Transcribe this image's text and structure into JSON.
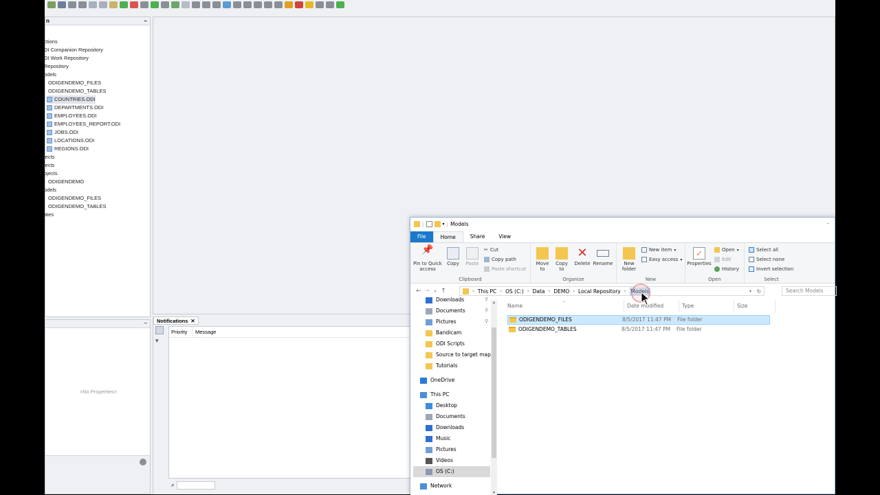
{
  "ide": {
    "tree_header": "n",
    "tree_items": [
      {
        "label": "ctions",
        "indent": 0,
        "icon": false
      },
      {
        "label": "DI Companion Repository",
        "indent": 0,
        "icon": false
      },
      {
        "label": "DI Work Repository",
        "indent": 0,
        "icon": false
      },
      {
        "label": "Repository",
        "indent": 0,
        "icon": false
      },
      {
        "label": "odels",
        "indent": 0,
        "icon": false
      },
      {
        "label": "ODIGENDEMO_FILES",
        "indent": 1,
        "icon": false
      },
      {
        "label": "ODIGENDEMO_TABLES",
        "indent": 1,
        "icon": false
      },
      {
        "label": "COUNTRIES.ODI",
        "indent": 2,
        "icon": true,
        "selected": true
      },
      {
        "label": "DEPARTMENTS.ODI",
        "indent": 2,
        "icon": true
      },
      {
        "label": "EMPLOYEES.ODI",
        "indent": 2,
        "icon": true
      },
      {
        "label": "EMPLOYEES_REPORT.ODI",
        "indent": 2,
        "icon": true
      },
      {
        "label": "JOBS.ODI",
        "indent": 2,
        "icon": true
      },
      {
        "label": "LOCATIONS.ODI",
        "indent": 2,
        "icon": true
      },
      {
        "label": "REGIONS.ODI",
        "indent": 2,
        "icon": true
      },
      {
        "label": "jects",
        "indent": 0,
        "icon": false
      },
      {
        "label": "jects",
        "indent": 0,
        "icon": false
      },
      {
        "label": "ojects",
        "indent": 0,
        "icon": false
      },
      {
        "label": "ODIGENDEMO",
        "indent": 1,
        "icon": false
      },
      {
        "label": "odels",
        "indent": 0,
        "icon": false
      },
      {
        "label": "ODIGENDEMO_FILES",
        "indent": 1,
        "icon": false
      },
      {
        "label": "ODIGENDEMO_TABLES",
        "indent": 1,
        "icon": false
      },
      {
        "label": "ates",
        "indent": 0,
        "icon": false
      }
    ],
    "properties_empty": "<No Properties>",
    "notifications_tab": "Notifications",
    "notifications_columns": [
      "Priority",
      "Message"
    ]
  },
  "explorer": {
    "title": "Models",
    "tabs": [
      "File",
      "Home",
      "Share",
      "View"
    ],
    "ribbon": {
      "clipboard": {
        "label": "Clipboard",
        "pin": "Pin to Quick access",
        "copy": "Copy",
        "paste": "Paste",
        "cut": "Cut",
        "copy_path": "Copy path",
        "paste_shortcut": "Paste shortcut"
      },
      "organize": {
        "label": "Organize",
        "move_to": "Move to",
        "copy_to": "Copy to",
        "delete": "Delete",
        "rename": "Rename"
      },
      "new": {
        "label": "New",
        "new_folder": "New folder",
        "new_item": "New item",
        "easy_access": "Easy access"
      },
      "open": {
        "label": "Open",
        "properties": "Properties",
        "open": "Open",
        "edit": "Edit",
        "history": "History"
      },
      "select": {
        "label": "Select",
        "select_all": "Select all",
        "select_none": "Select none",
        "invert": "Invert selection"
      }
    },
    "breadcrumbs": [
      "This PC",
      "OS (C:)",
      "Data",
      "DEMO",
      "Local Repository",
      "Models"
    ],
    "search_placeholder": "Search Models",
    "nav_items": [
      {
        "label": "Downloads",
        "icon": "download-icon",
        "pinned": true,
        "level": 1
      },
      {
        "label": "Documents",
        "icon": "documents-icon",
        "pinned": true,
        "level": 1
      },
      {
        "label": "Pictures",
        "icon": "pictures-icon",
        "pinned": true,
        "level": 1
      },
      {
        "label": "Bandicam",
        "icon": "folder-icon",
        "level": 1
      },
      {
        "label": "ODI Scripts",
        "icon": "folder-icon",
        "level": 1
      },
      {
        "label": "Source to target mappi",
        "icon": "folder-icon",
        "level": 1
      },
      {
        "label": "Tutorials",
        "icon": "folder-icon",
        "level": 1
      },
      {
        "label": "OneDrive",
        "icon": "onedrive-icon",
        "level": 0
      },
      {
        "label": "This PC",
        "icon": "computer-icon",
        "level": 0
      },
      {
        "label": "Desktop",
        "icon": "desktop-icon",
        "level": 1
      },
      {
        "label": "Documents",
        "icon": "documents-icon",
        "level": 1
      },
      {
        "label": "Downloads",
        "icon": "download-icon",
        "level": 1
      },
      {
        "label": "Music",
        "icon": "music-icon",
        "level": 1
      },
      {
        "label": "Pictures",
        "icon": "pictures-icon",
        "level": 1
      },
      {
        "label": "Videos",
        "icon": "videos-icon",
        "level": 1
      },
      {
        "label": "OS (C:)",
        "icon": "drive-icon",
        "level": 1,
        "selected": true
      },
      {
        "label": "Network",
        "icon": "network-icon",
        "level": 0
      }
    ],
    "columns": [
      "Name",
      "Date modified",
      "Type",
      "Size"
    ],
    "files": [
      {
        "name": "ODIGENDEMO_FILES",
        "date": "8/5/2017 11:47 PM",
        "type": "File folder",
        "size": "",
        "selected": true
      },
      {
        "name": "ODIGENDEMO_TABLES",
        "date": "8/5/2017 11:47 PM",
        "type": "File folder",
        "size": ""
      }
    ]
  },
  "colors": {
    "accent": "#1979ca",
    "selection": "#cce8ff",
    "folder": "#f4c650"
  }
}
